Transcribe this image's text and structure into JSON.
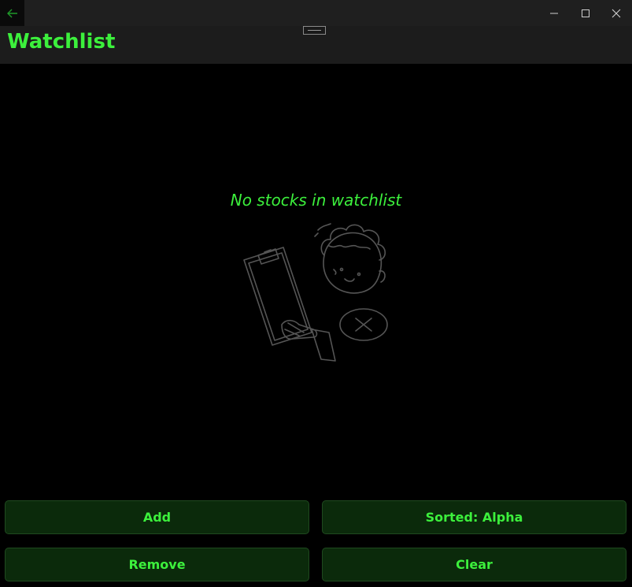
{
  "window": {
    "caption_buttons": [
      "minimize-icon",
      "maximize-icon",
      "close-icon"
    ],
    "back_icon": "arrow-left-icon"
  },
  "header": {
    "title": "Watchlist"
  },
  "empty_state": {
    "message": "No stocks in watchlist",
    "illustration": "person-holding-clipboard-illustration"
  },
  "buttons": {
    "add": "Add",
    "sort": "Sorted: Alpha",
    "remove": "Remove",
    "clear": "Clear"
  },
  "colors": {
    "accent": "#3cf03c",
    "button_bg": "#0b2a0b",
    "header_bg": "#1c1c1c",
    "background": "#000000"
  }
}
